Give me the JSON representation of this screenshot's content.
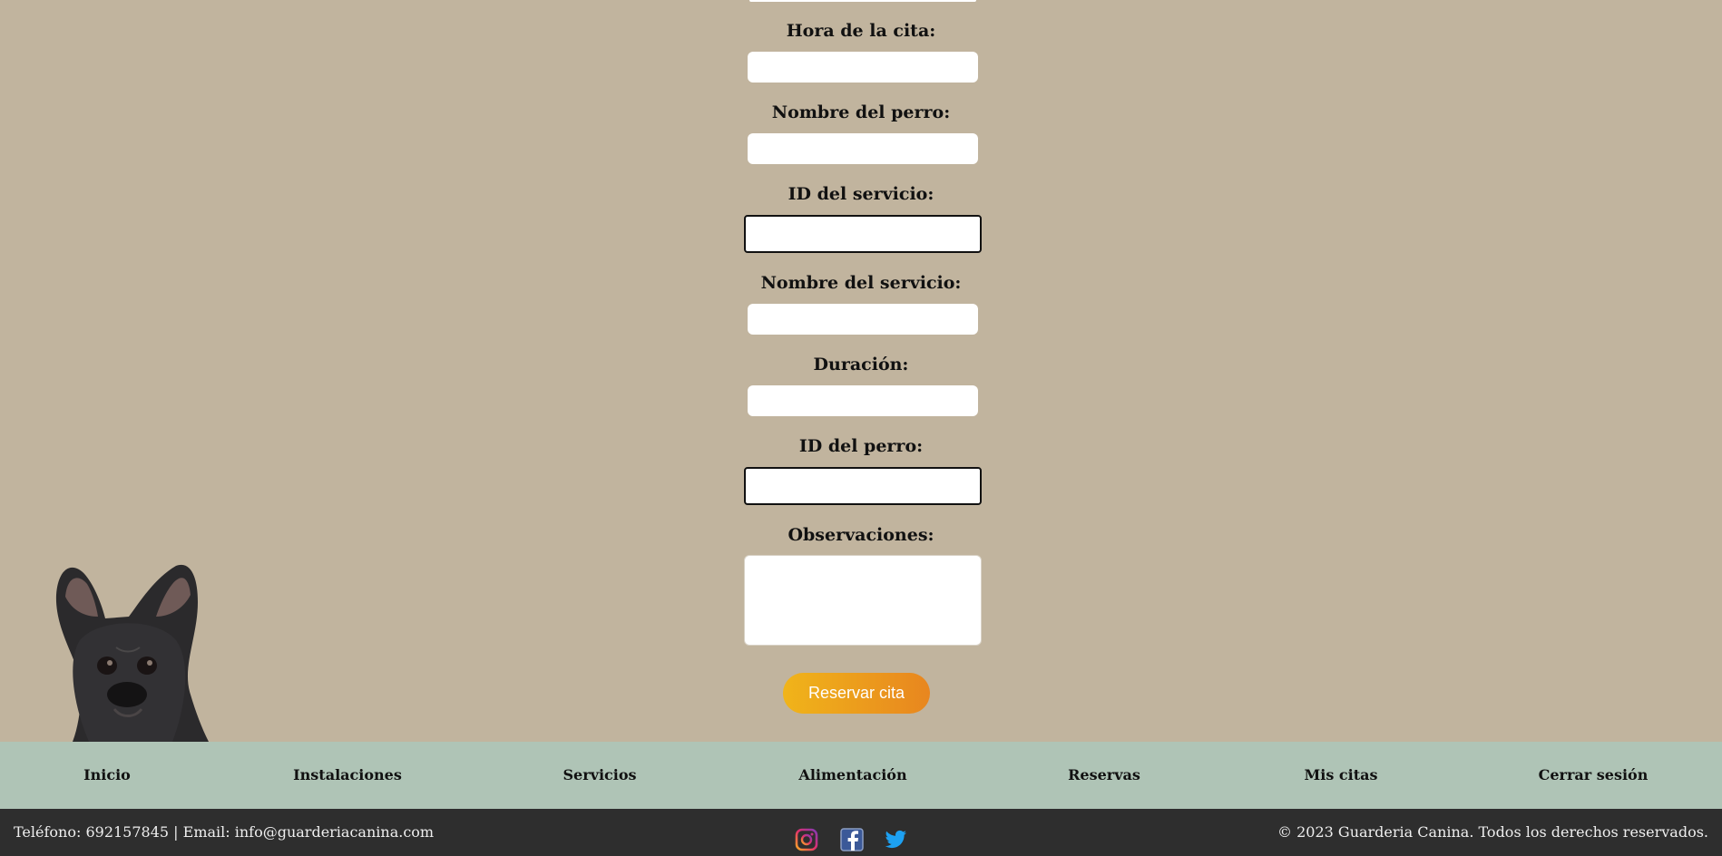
{
  "form": {
    "fields": [
      {
        "label": "Hora de la cita:",
        "value": ""
      },
      {
        "label": "Nombre del perro:",
        "value": ""
      },
      {
        "label": "ID del servicio:",
        "value": ""
      },
      {
        "label": "Nombre del servicio:",
        "value": ""
      },
      {
        "label": "Duración:",
        "value": ""
      },
      {
        "label": "ID del perro:",
        "value": ""
      }
    ],
    "observations": {
      "label": "Observaciones:",
      "value": ""
    },
    "submit_label": "Reservar cita"
  },
  "nav": {
    "items": [
      {
        "label": "Inicio"
      },
      {
        "label": "Instalaciones"
      },
      {
        "label": "Servicios"
      },
      {
        "label": "Alimentación"
      },
      {
        "label": "Reservas"
      },
      {
        "label": "Mis citas"
      },
      {
        "label": "Cerrar sesión"
      }
    ]
  },
  "footer": {
    "contact": "Teléfono: 692157845 | Email: info@guarderiacanina.com",
    "copyright": "© 2023 Guarderia Canina. Todos los derechos reservados.",
    "social": [
      {
        "icon": "instagram-icon"
      },
      {
        "icon": "facebook-icon"
      },
      {
        "icon": "twitter-icon"
      }
    ]
  },
  "colors": {
    "page_background": "#c1b49e",
    "nav_background": "#afc4b6",
    "footer_background": "#2e2e2e",
    "button_gradient": [
      "#f0b41a",
      "#e8861f"
    ]
  }
}
